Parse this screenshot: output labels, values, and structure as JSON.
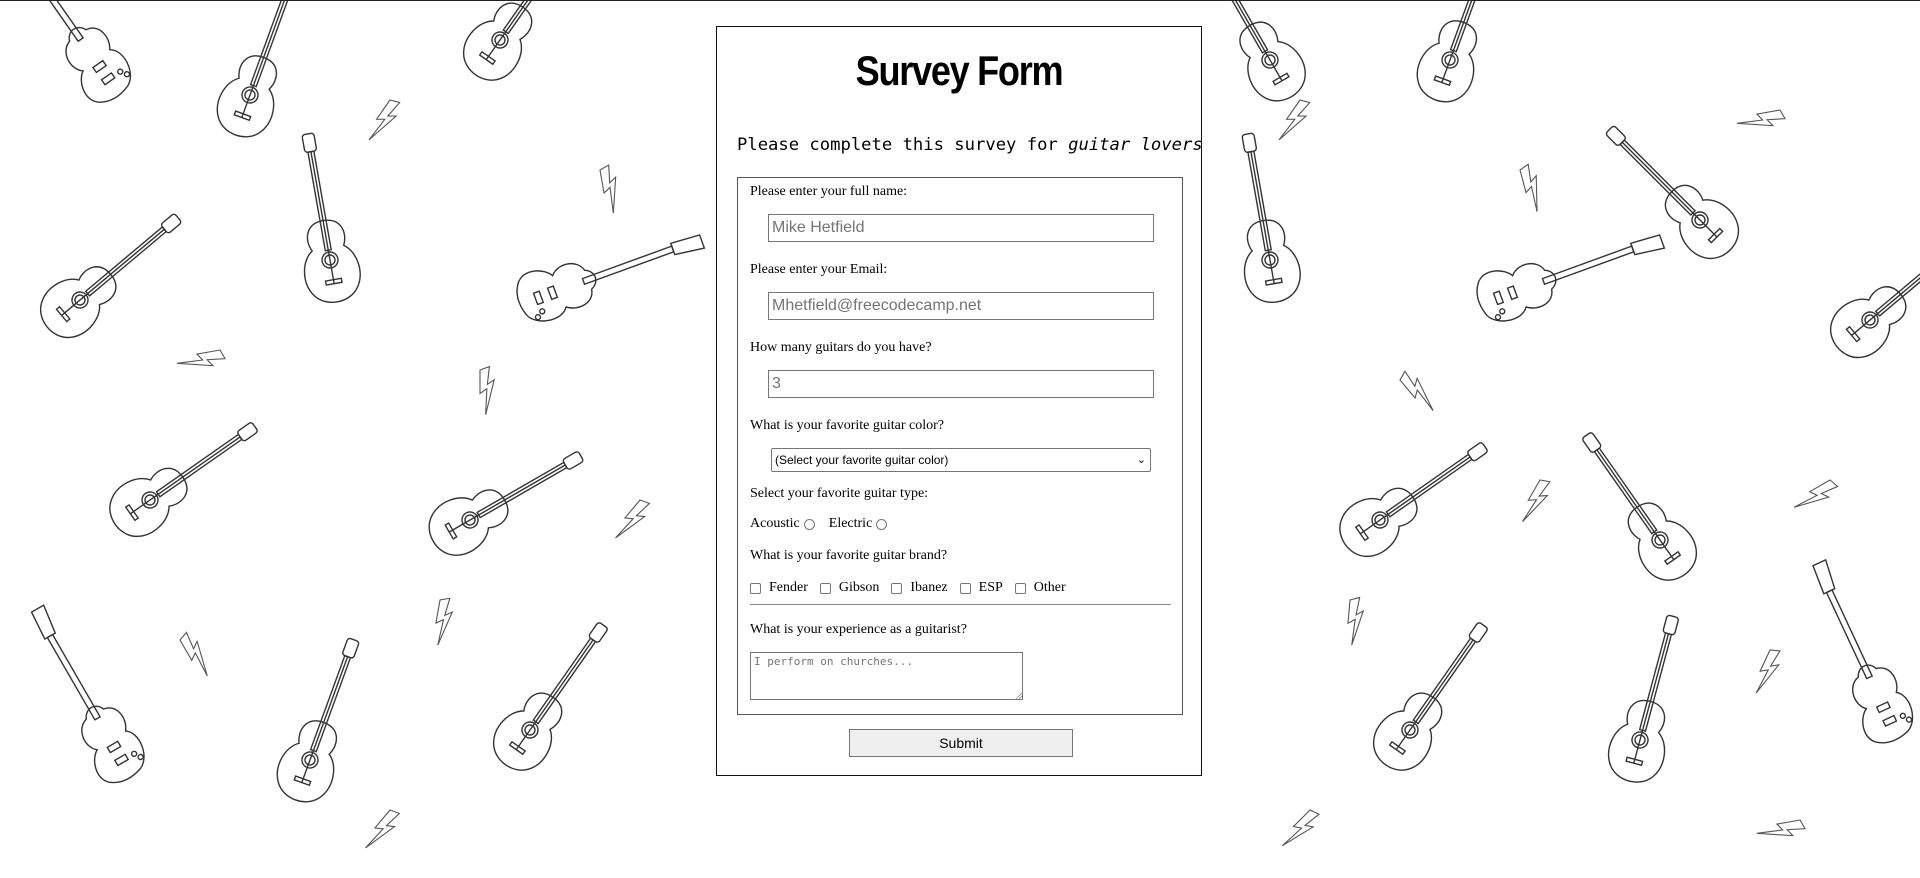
{
  "form": {
    "title": "Survey Form",
    "subtitle_prefix": "Please complete this survey for ",
    "subtitle_emphasis": "guitar lovers",
    "name": {
      "label": "Please enter your full name:",
      "placeholder": "Mike Hetfield"
    },
    "email": {
      "label": "Please enter your Email:",
      "placeholder": "Mhetfield@freecodecamp.net"
    },
    "count": {
      "label": "How many guitars do you have?",
      "placeholder": "3"
    },
    "color": {
      "label": "What is your favorite guitar color?",
      "selected": "(Select your favorite guitar color)"
    },
    "type": {
      "label": "Select your favorite guitar type:",
      "options": [
        "Acoustic",
        "Electric"
      ]
    },
    "brand": {
      "label": "What is your favorite guitar brand?",
      "options": [
        "Fender",
        "Gibson",
        "Ibanez",
        "ESP",
        "Other"
      ]
    },
    "experience": {
      "label": "What is your experience as a guitarist?",
      "placeholder": "I perform on churches..."
    },
    "submit_label": "Submit"
  },
  "background": {
    "pattern": "guitar-doodle-pattern",
    "stroke_color": "#333333",
    "base_color": "#ffffff"
  }
}
